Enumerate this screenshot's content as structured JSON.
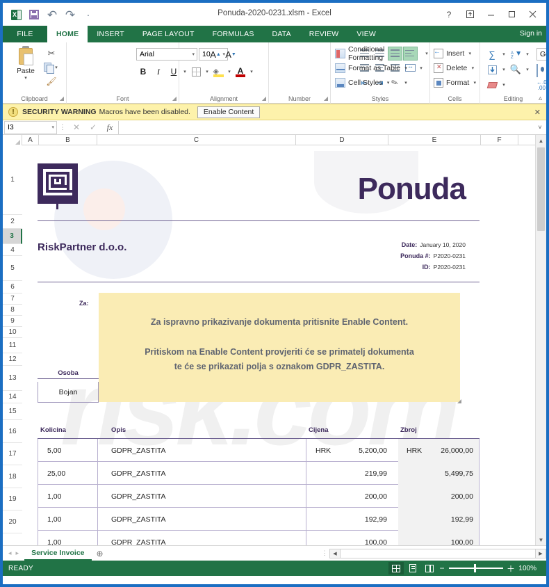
{
  "window": {
    "title": "Ponuda-2020-0231.xlsm - Excel",
    "quick_access": [
      "excel-logo",
      "save-icon",
      "undo-icon",
      "redo-icon",
      "customize-qat-icon"
    ],
    "controls": [
      "help-icon",
      "ribbon-display-options-icon",
      "minimize-icon",
      "restore-icon",
      "close-icon"
    ],
    "sign_in": "Sign in"
  },
  "ribbon": {
    "tabs": [
      {
        "label": "FILE",
        "active": false
      },
      {
        "label": "HOME",
        "active": true
      },
      {
        "label": "INSERT",
        "active": false
      },
      {
        "label": "PAGE LAYOUT",
        "active": false
      },
      {
        "label": "FORMULAS",
        "active": false
      },
      {
        "label": "DATA",
        "active": false
      },
      {
        "label": "REVIEW",
        "active": false
      },
      {
        "label": "VIEW",
        "active": false
      }
    ],
    "groups": {
      "clipboard": {
        "label": "Clipboard",
        "paste": "Paste",
        "cut": "cut-icon",
        "copy": "copy-icon",
        "format_painter": "format-painter-icon"
      },
      "font": {
        "label": "Font",
        "font_name": "Arial",
        "font_size": "10",
        "grow": "A",
        "shrink": "A",
        "bold": "B",
        "italic": "I",
        "underline": "U",
        "borders": "borders-icon",
        "fill_color": "fill-color-icon",
        "font_color": "font-color-icon"
      },
      "alignment": {
        "label": "Alignment",
        "wrap_text": "wrap-text-icon",
        "merge_center": "merge-and-center-icon"
      },
      "number": {
        "label": "Number",
        "format": "General",
        "accounting": "accounting-format-icon",
        "percent": "%",
        "comma": "͵",
        "increase_decimal": ".00",
        "decrease_decimal": ".0"
      },
      "styles": {
        "label": "Styles",
        "items": [
          "Conditional Formatting",
          "Format as Table",
          "Cell Styles"
        ]
      },
      "cells": {
        "label": "Cells",
        "items": [
          "Insert",
          "Delete",
          "Format"
        ]
      },
      "editing": {
        "label": "Editing",
        "autosum": "∑",
        "fill": "fill-icon",
        "clear": "clear-icon",
        "sort_filter": "sort-and-filter-icon",
        "find_select": "find-and-select-icon"
      }
    },
    "collapse": "collapse-ribbon-icon"
  },
  "security_warning": {
    "icon": "warning-icon",
    "bold_label": "SECURITY WARNING",
    "message": "Macros have been disabled.",
    "button": "Enable Content",
    "close": "✕"
  },
  "formula_bar": {
    "name_box": "I3",
    "cancel": "✕",
    "enter": "✓",
    "function": "fx",
    "value": "",
    "expand": "˅"
  },
  "grid": {
    "columns": [
      "A",
      "B",
      "C",
      "D",
      "E",
      "F"
    ],
    "rows": [
      "1",
      "2",
      "3",
      "4",
      "5",
      "6",
      "7",
      "8",
      "9",
      "10",
      "11",
      "12",
      "13",
      "14",
      "15",
      "16",
      "17",
      "18",
      "19",
      "20"
    ],
    "selected_row": "3"
  },
  "invoice": {
    "logo": "riskpartner-maze-logo",
    "title": "Ponuda",
    "company": "RiskPartner d.o.o.",
    "meta": [
      {
        "label": "Date:",
        "value": "January 10, 2020"
      },
      {
        "label": "Ponuda #:",
        "value": "P2020-0231"
      },
      {
        "label": "ID:",
        "value": "P2020-0231"
      }
    ],
    "za_label": "Za:",
    "lure_message": {
      "line1": "Za ispravno prikazivanje dokumenta pritisnite Enable Content.",
      "line2": "Pritiskom na Enable Content provjeriti će se primatelj dokumenta",
      "line3": "te će se prikazati polja s oznakom GDPR_ZASTITA."
    },
    "osoba_label": "Osoba",
    "osoba_value": "Bojan",
    "table": {
      "headers": [
        "Kolicina",
        "Opis",
        "Cijena",
        "Zbroj"
      ],
      "rows": [
        {
          "kolicina": "5,00",
          "opis": "GDPR_ZASTITA",
          "cijena_cur": "HRK",
          "cijena": "5,200,00",
          "zbroj_cur": "HRK",
          "zbroj": "26,000,00"
        },
        {
          "kolicina": "25,00",
          "opis": "GDPR_ZASTITA",
          "cijena_cur": "",
          "cijena": "219,99",
          "zbroj_cur": "",
          "zbroj": "5,499,75"
        },
        {
          "kolicina": "1,00",
          "opis": "GDPR_ZASTITA",
          "cijena_cur": "",
          "cijena": "200,00",
          "zbroj_cur": "",
          "zbroj": "200,00"
        },
        {
          "kolicina": "1,00",
          "opis": "GDPR_ZASTITA",
          "cijena_cur": "",
          "cijena": "192,99",
          "zbroj_cur": "",
          "zbroj": "192,99"
        },
        {
          "kolicina": "1,00",
          "opis": "GDPR_ZASTITA",
          "cijena_cur": "",
          "cijena": "100,00",
          "zbroj_cur": "",
          "zbroj": "100,00"
        }
      ]
    }
  },
  "sheet_tabs": {
    "active": "Service Invoice",
    "add": "⊕",
    "prev": "◂",
    "next": "▸"
  },
  "status_bar": {
    "state": "READY",
    "views": [
      "normal-view-icon",
      "page-layout-view-icon",
      "page-break-preview-icon"
    ],
    "zoom_out": "−",
    "zoom_in": "＋",
    "zoom_level": "100%"
  },
  "colors": {
    "excel_green": "#217346",
    "window_blue": "#1b6ec2",
    "invoice_purple": "#3d2a5c",
    "warning_yellow": "#fdf2ab",
    "lure_yellow": "#faecb4"
  }
}
